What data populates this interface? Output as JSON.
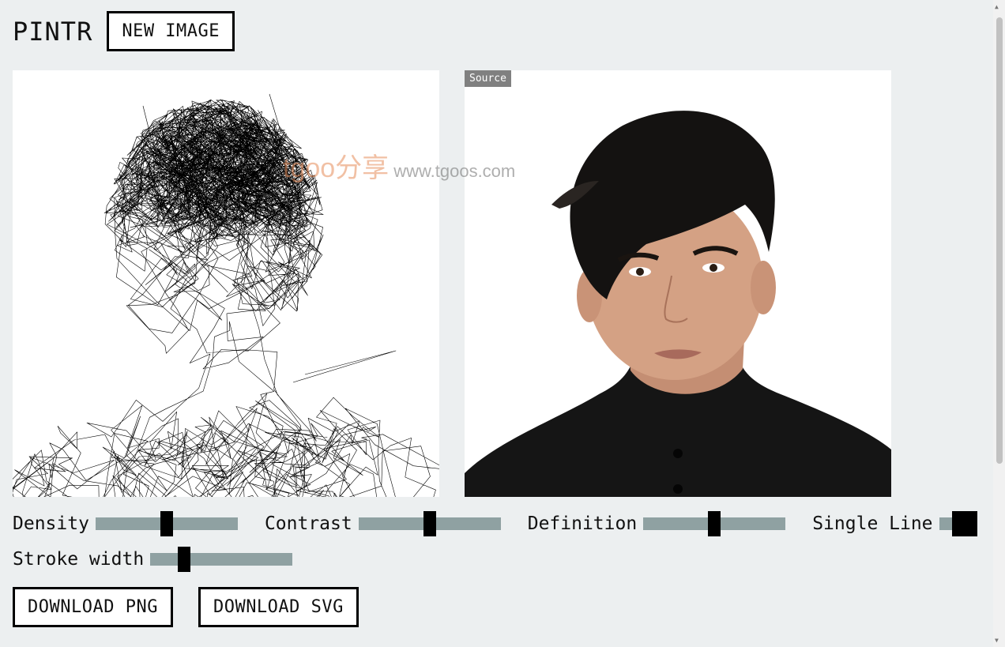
{
  "app": {
    "logo": "PINTR",
    "new_image_label": "NEW IMAGE"
  },
  "source_badge": "Source",
  "watermark": {
    "brand": "tgoo分享",
    "url": "www.tgoos.com"
  },
  "controls": {
    "density": {
      "label": "Density",
      "value": 0.5
    },
    "contrast": {
      "label": "Contrast",
      "value": 0.5
    },
    "definition": {
      "label": "Definition",
      "value": 0.5
    },
    "single_line": {
      "label": "Single Line",
      "on": true
    },
    "stroke_width": {
      "label": "Stroke width",
      "value": 0.24
    }
  },
  "downloads": {
    "png_label": "DOWNLOAD PNG",
    "svg_label": "DOWNLOAD SVG"
  },
  "colors": {
    "background": "#eceff0",
    "slider_track": "#8fa1a2",
    "badge_bg": "#808080"
  }
}
